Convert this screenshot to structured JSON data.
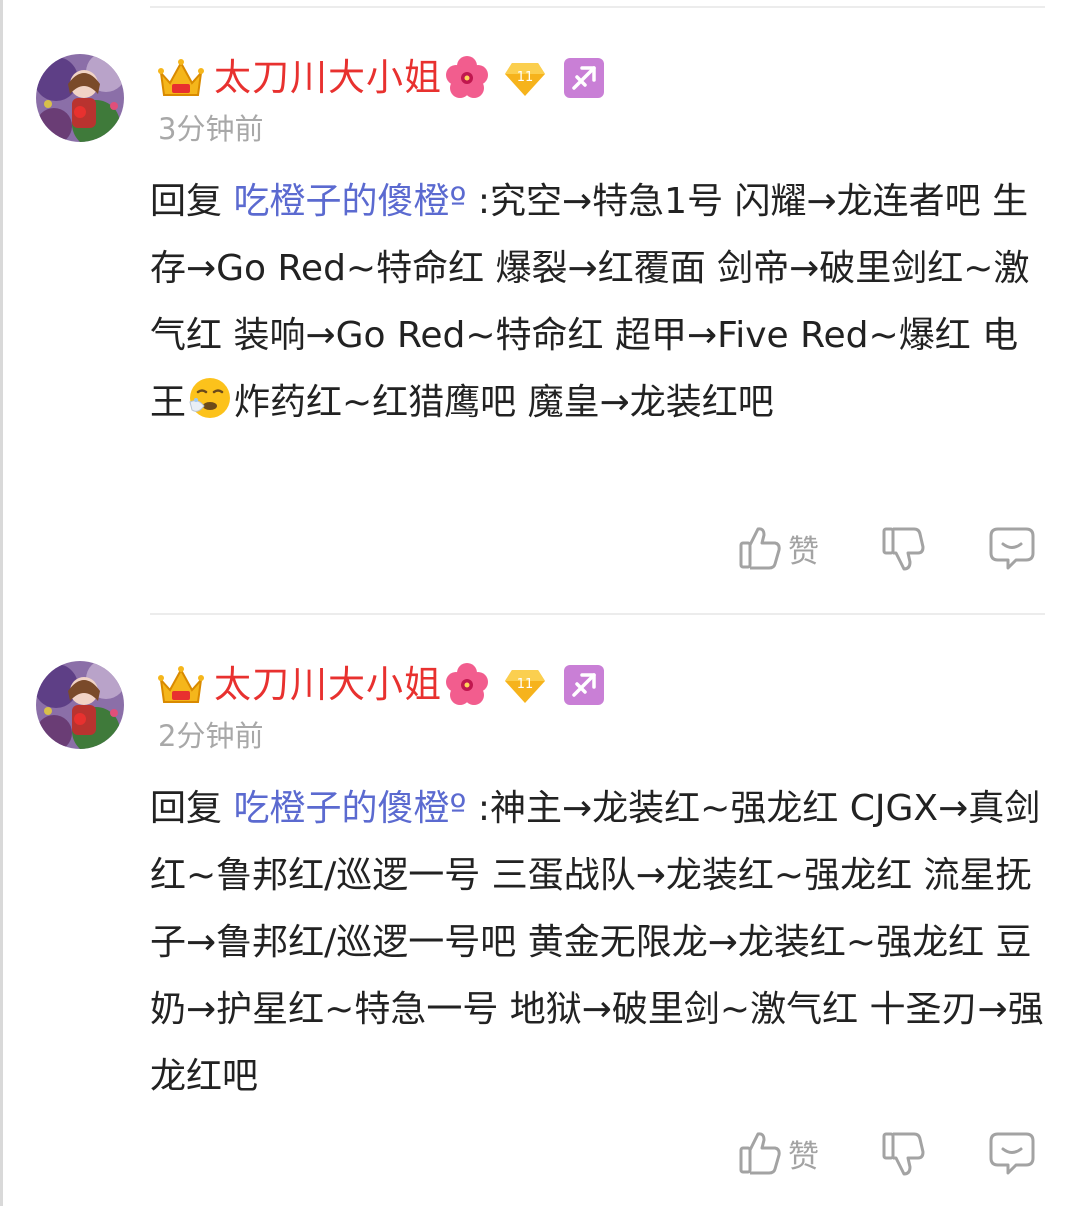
{
  "comments": [
    {
      "username": "太刀川大小姐",
      "level": "11",
      "time": "3分钟前",
      "reply_prefix": "回复 ",
      "reply_target": "吃橙子的傻橙º",
      "text_before_emoji": " :究空→特急1号 闪耀→龙连者吧 生存→Go Red~特命红 爆裂→红覆面 剑帝→破里剑红~激气红 装响→Go Red~特命红 超甲→Five Red~爆红 电王",
      "text_after_emoji": "炸药红~红猎鹰吧 魔皇→龙装红吧",
      "like_label": "赞"
    },
    {
      "username": "太刀川大小姐",
      "level": "11",
      "time": "2分钟前",
      "reply_prefix": "回复 ",
      "reply_target": "吃橙子的傻橙º",
      "text": " :神主→龙装红~强龙红 CJGX→真剑红~鲁邦红/巡逻一号 三蛋战队→龙装红~强龙红 流星抚子→鲁邦红/巡逻一号吧 黄金无限龙→龙装红~强龙红 豆奶→护星红~特急一号 地狱→破里剑~激气红 十圣刃→强龙红吧",
      "like_label": "赞"
    }
  ],
  "icons": {
    "badge": "crown-badge-icon",
    "flower": "hibiscus-icon",
    "level": "diamond-level-icon",
    "zodiac": "sagittarius-icon",
    "emoji": "sneezing-face-icon",
    "like": "thumbs-up-icon",
    "dislike": "thumbs-down-icon",
    "reply": "comment-bubble-icon"
  },
  "colors": {
    "username": "#e8312f",
    "reply_target": "#5b6ad0",
    "time": "#a8a8a8",
    "action": "#a3a3a3",
    "zodiac_bg": "#c97fd6",
    "level_bg": "#f6b31c"
  }
}
